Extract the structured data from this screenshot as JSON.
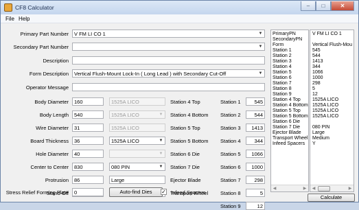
{
  "window": {
    "title": "CF8 Calculator",
    "controls": [
      "–",
      "□",
      "✕"
    ]
  },
  "menu": {
    "file": "File",
    "help": "Help"
  },
  "form": {
    "primary_label": "Primary Part Number",
    "primary_value": "V FM LI CO 1",
    "secondary_label": "Secondary Part Number",
    "secondary_value": "",
    "description_label": "Description",
    "description_value": "",
    "form_desc_label": "Form Description",
    "form_desc_value": "Vertical Flush-Mount Lock-In ( Long Lead ) with Secondary Cut-Off",
    "operator_label": "Operator Message",
    "operator_value": ""
  },
  "params": [
    {
      "label": "Body Diameter",
      "value": "160",
      "sel": "1525A LICO",
      "sel_dd": false,
      "sel_disabled": true
    },
    {
      "label": "Body Length",
      "value": "540",
      "sel": "1525A LICO",
      "sel_dd": true,
      "sel_disabled": true
    },
    {
      "label": "Wire Diameter",
      "value": "31",
      "sel": "1525A LICO",
      "sel_dd": false,
      "sel_disabled": true
    },
    {
      "label": "Board Thickness",
      "value": "36",
      "sel": "1525A LICO",
      "sel_dd": true,
      "sel_disabled": false
    },
    {
      "label": "Hole Diameter",
      "value": "40",
      "sel": "",
      "sel_dd": true,
      "sel_disabled": true
    },
    {
      "label": "Center to Center",
      "value": "830",
      "sel": "080 PIN",
      "sel_dd": true,
      "sel_disabled": false
    },
    {
      "label": "Protrusion",
      "value": "86",
      "sel": "Large",
      "sel_dd": false,
      "sel_disabled": false
    },
    {
      "label": "Stand-Off",
      "value": "0",
      "sel": "Medium",
      "sel_dd": false,
      "sel_disabled": false
    }
  ],
  "stress": {
    "label": "Stress Relief Forming Plate",
    "value": "0"
  },
  "autofind_button": "Auto-find Dies",
  "infeed": {
    "checked": "✓",
    "label": "Infeed Spacers"
  },
  "mid_labels": [
    "Station 4 Top",
    "Station 4 Bottom",
    "Station 5 Top",
    "Station 5 Bottom",
    "Station 6 Die",
    "Station 7 Die",
    "Ejector Blade",
    "Transport Wheel"
  ],
  "stations": [
    {
      "label": "Station 1",
      "value": "545"
    },
    {
      "label": "Station 2",
      "value": "544"
    },
    {
      "label": "Station 3",
      "value": "1413"
    },
    {
      "label": "Station 4",
      "value": "344"
    },
    {
      "label": "Station 5",
      "value": "1066"
    },
    {
      "label": "Station 6",
      "value": "1000"
    },
    {
      "label": "Station 7",
      "value": "298"
    },
    {
      "label": "Station 8",
      "value": "5"
    },
    {
      "label": "Station 9",
      "value": "12"
    }
  ],
  "summary_keys": [
    "PrimaryPN",
    "SecondaryPN",
    "Form",
    "Station 1",
    "Station 2",
    "Station 3",
    "Station 4",
    "Station 5",
    "Station 6",
    "Station 7",
    "Station 8",
    "Station 9",
    "Station 4 Top",
    "Station 4 Bottom",
    "Station 5 Top",
    "Station 5 Bottom",
    "Station 6 Die",
    "Station 7 Die",
    "Ejector Blade",
    "Transport Wheel",
    "Infeed Spacers"
  ],
  "summary_values": [
    "V FM LI CO 1",
    "",
    "Vertical Flush-Mou",
    "545",
    "544",
    "1413",
    "344",
    "1066",
    "1000",
    "298",
    "5",
    "12",
    "1525A LICO",
    "1525A LICO",
    "1525A LICO",
    "1525A LICO",
    "",
    "080 PIN",
    "Large",
    "Medium",
    "Y"
  ],
  "calculate_button": "Calculate",
  "icons": {
    "dropdown": "▼",
    "left": "◀",
    "right": "▶"
  }
}
